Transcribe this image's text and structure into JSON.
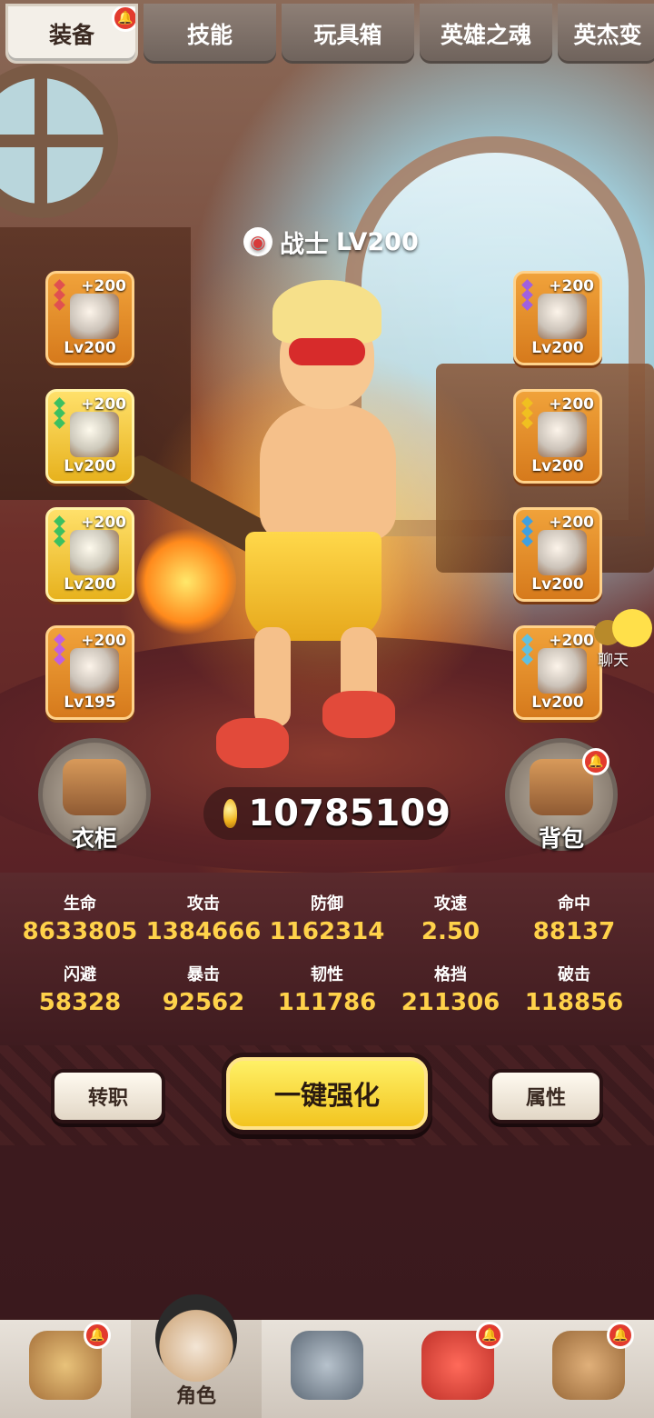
{
  "tabs": [
    {
      "label": "装备",
      "active": true,
      "badge": true
    },
    {
      "label": "技能"
    },
    {
      "label": "玩具箱"
    },
    {
      "label": "英雄之魂"
    },
    {
      "label": "英杰变"
    }
  ],
  "hero": {
    "class": "战士",
    "level": "LV200"
  },
  "slots_left": [
    {
      "plus": "+200",
      "level": "Lv200",
      "gem_color": "#e05050"
    },
    {
      "plus": "+200",
      "level": "Lv200",
      "gem_color": "#3cc060"
    },
    {
      "plus": "+200",
      "level": "Lv200",
      "gem_color": "#3cc060"
    },
    {
      "plus": "+200",
      "level": "Lv195",
      "gem_color": "#c060e0"
    }
  ],
  "slots_right": [
    {
      "plus": "+200",
      "level": "Lv200",
      "gem_color": "#a060e0"
    },
    {
      "plus": "+200",
      "level": "Lv200",
      "gem_color": "#f0c020"
    },
    {
      "plus": "+200",
      "level": "Lv200",
      "gem_color": "#40a0e0"
    },
    {
      "plus": "+200",
      "level": "Lv200",
      "gem_color": "#60c0e0"
    }
  ],
  "wardrobe": {
    "label": "衣柜"
  },
  "backpack": {
    "label": "背包"
  },
  "gold": {
    "value": "10785109"
  },
  "chat": {
    "label": "聊天"
  },
  "stats": [
    {
      "key": "生命",
      "value": "8633805"
    },
    {
      "key": "攻击",
      "value": "1384666"
    },
    {
      "key": "防御",
      "value": "1162314"
    },
    {
      "key": "攻速",
      "value": "2.50"
    },
    {
      "key": "命中",
      "value": "88137"
    },
    {
      "key": "闪避",
      "value": "58328"
    },
    {
      "key": "暴击",
      "value": "92562"
    },
    {
      "key": "韧性",
      "value": "111786"
    },
    {
      "key": "格挡",
      "value": "211306"
    },
    {
      "key": "破击",
      "value": "118856"
    }
  ],
  "buttons": {
    "job_change": "转职",
    "enhance_all": "一键强化",
    "attributes": "属性"
  },
  "nav": [
    {
      "label": "",
      "icon": "hero-stand-icon",
      "badge": true
    },
    {
      "label": "角色",
      "icon": "character-mask-icon",
      "active": true
    },
    {
      "label": "",
      "icon": "weapon-shield-icon"
    },
    {
      "label": "",
      "icon": "pet-dino-icon",
      "badge": true
    },
    {
      "label": "",
      "icon": "guild-ogre-icon",
      "badge": true
    }
  ],
  "colors": {
    "accent_gold": "#ffd24a",
    "slot_orange": "#e88a28",
    "badge_red": "#e23b2e"
  }
}
